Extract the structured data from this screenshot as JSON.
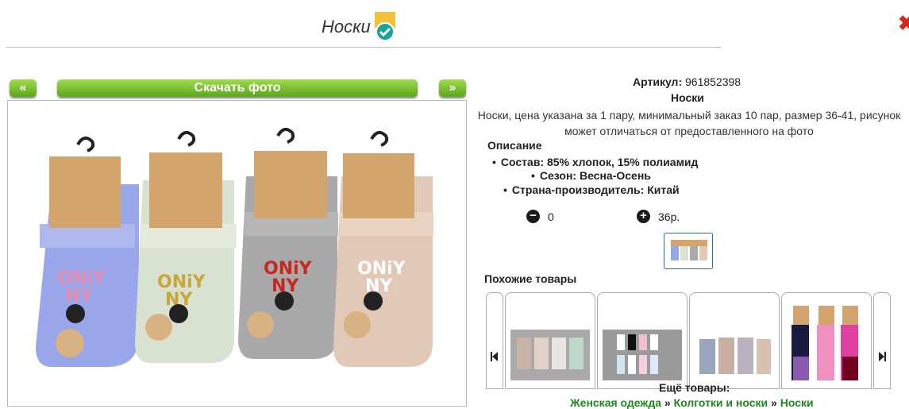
{
  "header": {
    "title": "Носки",
    "badge_icon": "verified-check-icon"
  },
  "gallery": {
    "prev_label": "«",
    "download_label": "Скачать фото",
    "next_label": "»"
  },
  "product": {
    "article_label": "Артикул:",
    "article_value": "961852398",
    "name": "Носки",
    "description": "Носки, цена указана за 1 пару, минимальный заказ 10 пар, размер 36-41, рисунок может отличаться от предоставленного на фото",
    "description_title": "Описание",
    "properties": [
      "Состав: 85% хлопок, 15% полиамид",
      "Сезон: Весна-Осень",
      "Страна-производитель: Китай"
    ],
    "quantity": "0",
    "price": "36р."
  },
  "similar": {
    "title": "Похожие товары"
  },
  "more": {
    "title": "Ещё товары:",
    "breadcrumbs": [
      "Женская одежда",
      "Колготки и носки",
      "Носки"
    ],
    "separator": "»"
  },
  "colors": {
    "accent_green": "#6bb52a",
    "link_green": "#1c8a1c",
    "close_red": "#d9261c"
  }
}
